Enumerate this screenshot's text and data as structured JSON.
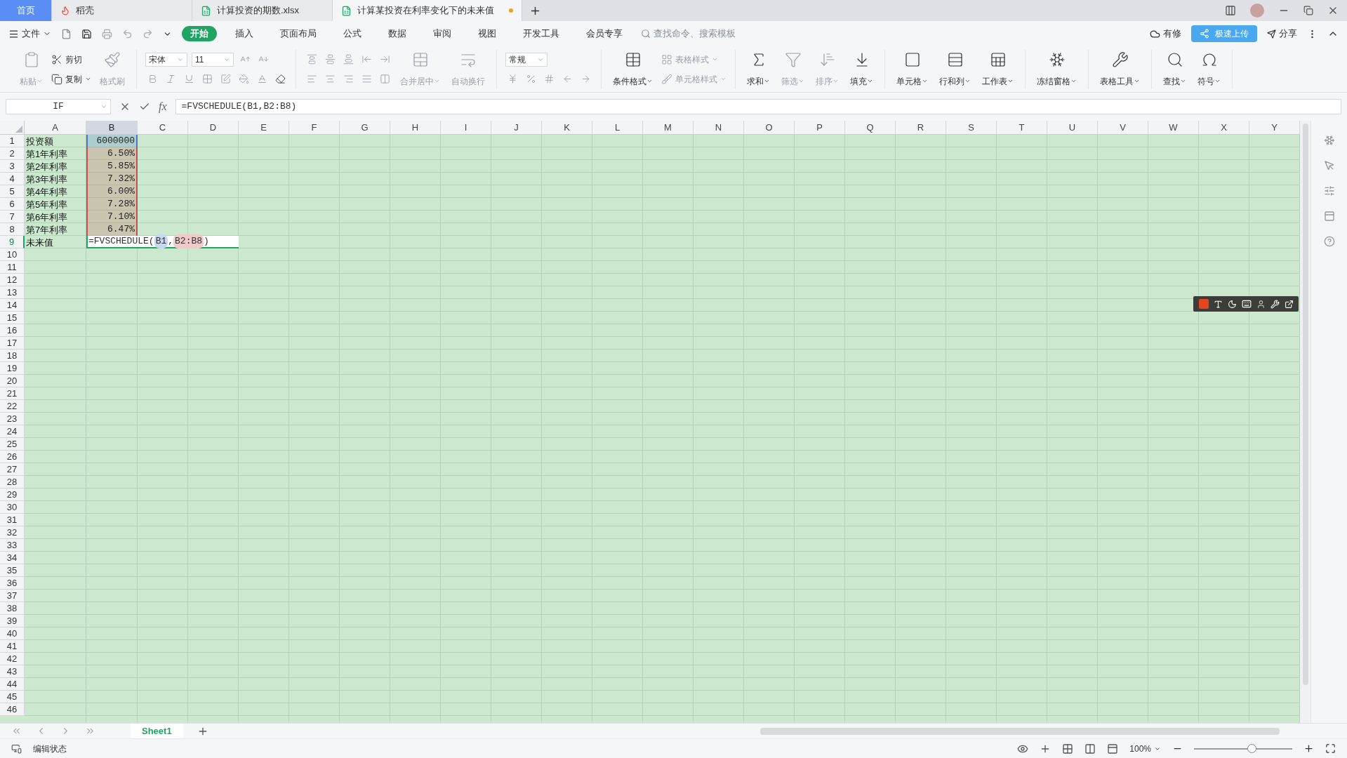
{
  "doc_tabs": [
    {
      "label": "首页",
      "kind": "home",
      "selected": false,
      "modified": false
    },
    {
      "label": "稻壳",
      "kind": "docer",
      "selected": false,
      "modified": false
    },
    {
      "label": "计算投资的期数.xlsx",
      "kind": "sheet",
      "selected": false,
      "modified": false
    },
    {
      "label": "计算某投资在利率变化下的未来值",
      "kind": "sheet",
      "selected": true,
      "modified": true
    }
  ],
  "menu": {
    "file": "文件",
    "tabs": [
      {
        "label": "开始",
        "selected": true
      },
      {
        "label": "插入",
        "selected": false
      },
      {
        "label": "页面布局",
        "selected": false
      },
      {
        "label": "公式",
        "selected": false
      },
      {
        "label": "数据",
        "selected": false
      },
      {
        "label": "审阅",
        "selected": false
      },
      {
        "label": "视图",
        "selected": false
      },
      {
        "label": "开发工具",
        "selected": false
      },
      {
        "label": "会员专享",
        "selected": false
      }
    ],
    "search": {
      "placeholder": "查找命令、搜索模板"
    },
    "status": "有修",
    "upload": "极速上传",
    "share": "分享"
  },
  "ribbon": [
    [
      [
        [
          {
            "kind": "big",
            "label": "粘贴",
            "disabled": true,
            "dropdown": true
          }
        ]
      ],
      [
        [
          {
            "kind": "small",
            "label": "剪切",
            "disabled": false,
            "dropdown": false
          }
        ],
        [
          {
            "kind": "small",
            "label": "复制",
            "disabled": false,
            "dropdown": true
          }
        ]
      ],
      [
        [
          {
            "kind": "big",
            "label": "格式刷",
            "disabled": true,
            "dropdown": false
          }
        ]
      ]
    ],
    [
      [
        [
          {
            "kind": "select",
            "label": "宋体"
          },
          {
            "kind": "select",
            "label": "11"
          },
          {
            "kind": "icon",
            "disabled": true
          },
          {
            "kind": "icon",
            "disabled": true
          }
        ],
        [
          {
            "kind": "icon",
            "disabled": true
          },
          {
            "kind": "icon",
            "disabled": true
          },
          {
            "kind": "icon",
            "disabled": true
          },
          {
            "kind": "icon",
            "disabled": true
          },
          {
            "kind": "icon",
            "disabled": true
          },
          {
            "kind": "icon",
            "disabled": true
          },
          {
            "kind": "icon",
            "disabled": true
          },
          {
            "kind": "icon",
            "disabled": false
          }
        ]
      ]
    ],
    [
      [
        [
          {
            "kind": "icon",
            "disabled": true
          },
          {
            "kind": "icon",
            "disabled": true
          },
          {
            "kind": "icon",
            "disabled": true
          },
          {
            "kind": "icon",
            "disabled": true
          },
          {
            "kind": "icon",
            "disabled": true
          }
        ],
        [
          {
            "kind": "icon",
            "disabled": true
          },
          {
            "kind": "icon",
            "disabled": true
          },
          {
            "kind": "icon",
            "disabled": true
          },
          {
            "kind": "icon",
            "disabled": true
          },
          {
            "kind": "icon",
            "disabled": true
          }
        ]
      ],
      [
        [
          {
            "kind": "big",
            "label": "合并居中",
            "disabled": true,
            "dropdown": true
          }
        ]
      ],
      [
        [
          {
            "kind": "big",
            "label": "自动换行",
            "disabled": true,
            "dropdown": false
          }
        ]
      ]
    ],
    [
      [
        [
          {
            "kind": "select",
            "label": "常规"
          }
        ],
        [
          {
            "kind": "icon",
            "disabled": true
          },
          {
            "kind": "icon",
            "disabled": true
          },
          {
            "kind": "icon",
            "disabled": true
          },
          {
            "kind": "icon",
            "disabled": true
          },
          {
            "kind": "icon",
            "disabled": true
          }
        ]
      ]
    ],
    [
      [
        [
          {
            "kind": "big",
            "label": "条件格式",
            "disabled": false,
            "dropdown": true
          }
        ]
      ],
      [
        [
          {
            "kind": "small",
            "label": "表格样式",
            "disabled": true,
            "dropdown": true
          }
        ],
        [
          {
            "kind": "small",
            "label": "单元格样式",
            "disabled": true,
            "dropdown": true
          }
        ]
      ]
    ],
    [
      [
        [
          {
            "kind": "big",
            "label": "求和",
            "disabled": false,
            "dropdown": true
          }
        ]
      ],
      [
        [
          {
            "kind": "big",
            "label": "筛选",
            "disabled": true,
            "dropdown": true
          }
        ]
      ],
      [
        [
          {
            "kind": "big",
            "label": "排序",
            "disabled": true,
            "dropdown": true
          }
        ]
      ],
      [
        [
          {
            "kind": "big",
            "label": "填充",
            "disabled": false,
            "dropdown": true
          }
        ]
      ]
    ],
    [
      [
        [
          {
            "kind": "big",
            "label": "单元格",
            "disabled": false,
            "dropdown": true
          }
        ]
      ],
      [
        [
          {
            "kind": "big",
            "label": "行和列",
            "disabled": false,
            "dropdown": true
          }
        ]
      ],
      [
        [
          {
            "kind": "big",
            "label": "工作表",
            "disabled": false,
            "dropdown": true
          }
        ]
      ]
    ],
    [
      [
        [
          {
            "kind": "big",
            "label": "冻结窗格",
            "disabled": false,
            "dropdown": true
          }
        ]
      ]
    ],
    [
      [
        [
          {
            "kind": "big",
            "label": "表格工具",
            "disabled": false,
            "dropdown": true
          }
        ]
      ]
    ],
    [
      [
        [
          {
            "kind": "big",
            "label": "查找",
            "disabled": false,
            "dropdown": true
          }
        ]
      ],
      [
        [
          {
            "kind": "big",
            "label": "符号",
            "disabled": false,
            "dropdown": true
          }
        ]
      ]
    ]
  ],
  "formula_bar": {
    "name_box": "IF",
    "fx": "fx",
    "formula": "=FVSCHEDULE(B1,B2:B8)"
  },
  "sheet": {
    "columns": [
      {
        "label": "A",
        "selected": false
      },
      {
        "label": "B",
        "selected": true
      },
      {
        "label": "C",
        "selected": false
      },
      {
        "label": "D",
        "selected": false
      },
      {
        "label": "E",
        "selected": false
      },
      {
        "label": "F",
        "selected": false
      },
      {
        "label": "G",
        "selected": false
      },
      {
        "label": "H",
        "selected": false
      },
      {
        "label": "I",
        "selected": false
      },
      {
        "label": "J",
        "selected": false
      },
      {
        "label": "K",
        "selected": false
      },
      {
        "label": "L",
        "selected": false
      },
      {
        "label": "M",
        "selected": false
      },
      {
        "label": "N",
        "selected": false
      },
      {
        "label": "O",
        "selected": false
      },
      {
        "label": "P",
        "selected": false
      },
      {
        "label": "Q",
        "selected": false
      },
      {
        "label": "R",
        "selected": false
      },
      {
        "label": "S",
        "selected": false
      },
      {
        "label": "T",
        "selected": false
      },
      {
        "label": "U",
        "selected": false
      },
      {
        "label": "V",
        "selected": false
      },
      {
        "label": "W",
        "selected": false
      },
      {
        "label": "X",
        "selected": false
      },
      {
        "label": "Y",
        "selected": false
      }
    ],
    "rows": [
      {
        "label": "1",
        "selected": false,
        "a": "投资额",
        "b": "6000000",
        "color": "#4a78c8"
      },
      {
        "label": "2",
        "selected": false,
        "a": "第1年利率",
        "b": "6.50%",
        "color": "#c8504a"
      },
      {
        "label": "3",
        "selected": false,
        "a": "第2年利率",
        "b": "5.85%",
        "color": "#c8504a"
      },
      {
        "label": "4",
        "selected": false,
        "a": "第3年利率",
        "b": "7.32%",
        "color": "#c8504a"
      },
      {
        "label": "5",
        "selected": false,
        "a": "第4年利率",
        "b": "6.00%",
        "color": "#c8504a"
      },
      {
        "label": "6",
        "selected": false,
        "a": "第5年利率",
        "b": "7.28%",
        "color": "#c8504a"
      },
      {
        "label": "7",
        "selected": false,
        "a": "第6年利率",
        "b": "7.10%",
        "color": "#c8504a"
      },
      {
        "label": "8",
        "selected": false,
        "a": "第7年利率",
        "b": "6.47%",
        "color": "#c8504a"
      },
      {
        "label": "9",
        "selected": true,
        "a": "未来值",
        "editing": true
      },
      {
        "label": "10",
        "selected": false
      },
      {
        "label": "11",
        "selected": false
      },
      {
        "label": "12",
        "selected": false
      },
      {
        "label": "13",
        "selected": false
      },
      {
        "label": "14",
        "selected": false
      },
      {
        "label": "15",
        "selected": false
      },
      {
        "label": "16",
        "selected": false
      },
      {
        "label": "17",
        "selected": false
      },
      {
        "label": "18",
        "selected": false
      },
      {
        "label": "19",
        "selected": false
      },
      {
        "label": "20",
        "selected": false
      },
      {
        "label": "21",
        "selected": false
      },
      {
        "label": "22",
        "selected": false
      },
      {
        "label": "23",
        "selected": false
      },
      {
        "label": "24",
        "selected": false
      },
      {
        "label": "25",
        "selected": false
      },
      {
        "label": "26",
        "selected": false
      },
      {
        "label": "27",
        "selected": false
      },
      {
        "label": "28",
        "selected": false
      },
      {
        "label": "29",
        "selected": false
      },
      {
        "label": "30",
        "selected": false
      },
      {
        "label": "31",
        "selected": false
      },
      {
        "label": "32",
        "selected": false
      },
      {
        "label": "33",
        "selected": false
      },
      {
        "label": "34",
        "selected": false
      },
      {
        "label": "35",
        "selected": false
      },
      {
        "label": "36",
        "selected": false
      },
      {
        "label": "37",
        "selected": false
      },
      {
        "label": "38",
        "selected": false
      },
      {
        "label": "39",
        "selected": false
      },
      {
        "label": "40",
        "selected": false
      },
      {
        "label": "41",
        "selected": false
      },
      {
        "label": "42",
        "selected": false
      },
      {
        "label": "43",
        "selected": false
      },
      {
        "label": "44",
        "selected": false
      },
      {
        "label": "45",
        "selected": false
      },
      {
        "label": "46",
        "selected": false
      }
    ]
  },
  "editor": {
    "parts": [
      {
        "kind": "text",
        "text": "=FVSCHEDULE("
      },
      {
        "kind": "ref",
        "text": "B1",
        "color": "#c8d8f0"
      },
      {
        "kind": "text",
        "text": ","
      },
      {
        "kind": "ref",
        "text": "B2:B8",
        "color": "#f2c8c8"
      },
      {
        "kind": "text",
        "text": ")"
      }
    ]
  },
  "sheet_tabs": [
    {
      "label": "Sheet1",
      "selected": true
    }
  ],
  "status_bar": {
    "mode": "编辑状态",
    "zoom": "100%",
    "zoom_slider": {
      "level": 0.6
    }
  }
}
